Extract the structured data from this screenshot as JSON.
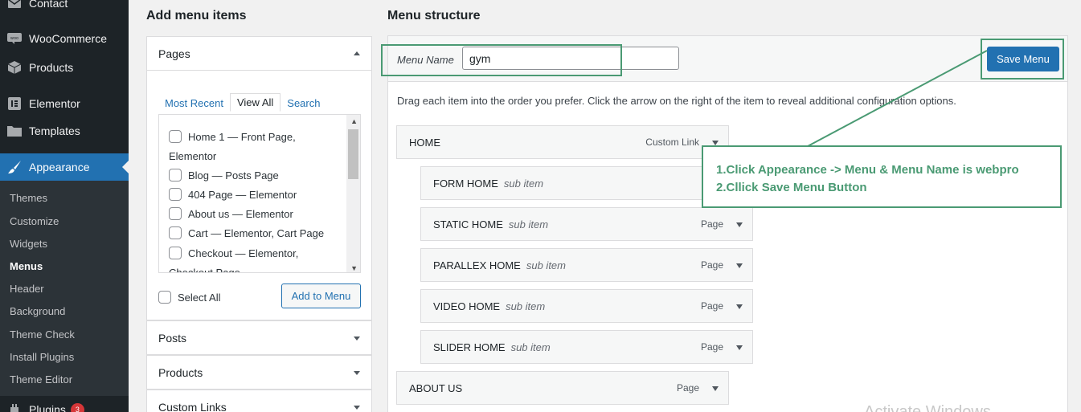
{
  "sidebar": {
    "items": [
      {
        "label": "Contact",
        "icon": "envelope-icon"
      },
      {
        "label": "WooCommerce",
        "icon": "woocommerce-icon"
      },
      {
        "label": "Products",
        "icon": "box-icon"
      },
      {
        "label": "Elementor",
        "icon": "elementor-icon"
      },
      {
        "label": "Templates",
        "icon": "folder-icon"
      },
      {
        "label": "Appearance",
        "icon": "paintbrush-icon"
      }
    ],
    "submenu": [
      "Themes",
      "Customize",
      "Widgets",
      "Menus",
      "Header",
      "Background",
      "Theme Check",
      "Install Plugins",
      "Theme Editor"
    ],
    "plugins": {
      "label": "Plugins",
      "badge": "3",
      "icon": "plugin-icon"
    }
  },
  "left": {
    "title": "Add menu items",
    "pages": {
      "header": "Pages",
      "tabs": [
        "Most Recent",
        "View All",
        "Search"
      ],
      "items": [
        {
          "name": "Home 1",
          "meta": "— Front Page,",
          "meta2": "Elementor"
        },
        {
          "name": "Blog",
          "meta": "— Posts Page"
        },
        {
          "name": "404 Page",
          "meta": "— Elementor"
        },
        {
          "name": "About us",
          "meta": "— Elementor"
        },
        {
          "name": "Cart",
          "meta": "— Elementor, Cart Page"
        },
        {
          "name": "Checkout",
          "meta": "— Elementor,",
          "meta2": "Checkout Page"
        }
      ],
      "select_all": "Select All",
      "add_button": "Add to Menu"
    },
    "sections": [
      "Posts",
      "Products",
      "Custom Links"
    ]
  },
  "right": {
    "title": "Menu structure",
    "menu_name_label": "Menu Name",
    "menu_name_value": "gym",
    "save_button": "Save Menu",
    "instructions": "Drag each item into the order you prefer. Click the arrow on the right of the item to reveal additional configuration options.",
    "items": [
      {
        "title": "HOME",
        "sub": "",
        "type": "Custom Link"
      },
      {
        "title": "FORM HOME",
        "sub": "sub item",
        "type": ""
      },
      {
        "title": "STATIC HOME",
        "sub": "sub item",
        "type": "Page"
      },
      {
        "title": "PARALLEX HOME",
        "sub": "sub item",
        "type": "Page"
      },
      {
        "title": "VIDEO HOME",
        "sub": "sub item",
        "type": "Page"
      },
      {
        "title": "SLIDER HOME",
        "sub": "sub item",
        "type": "Page"
      },
      {
        "title": "ABOUT US",
        "sub": "",
        "type": "Page"
      }
    ]
  },
  "annotation": {
    "line1": "1.Click Appearance -> Menu & Menu Name is webpro",
    "line2": "2.Cllick Save Menu Button",
    "color": "#4a9a73"
  },
  "watermark": "Activate Windows",
  "colors": {
    "accent": "#2271b1",
    "sidebar": "#1d2327",
    "submenu": "#2c3338"
  }
}
